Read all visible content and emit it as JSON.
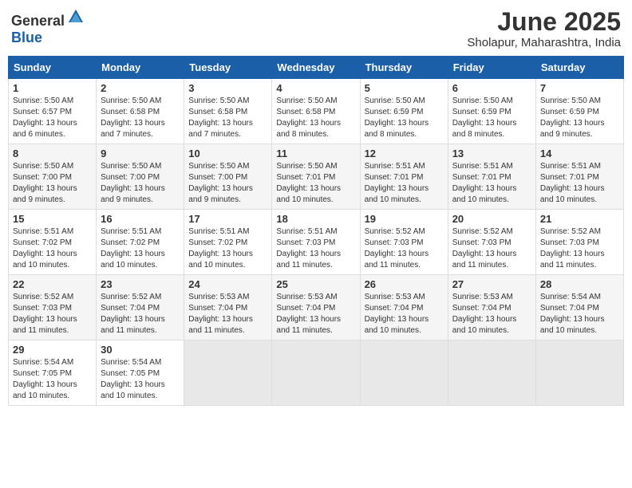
{
  "header": {
    "logo_general": "General",
    "logo_blue": "Blue",
    "month_title": "June 2025",
    "subtitle": "Sholapur, Maharashtra, India"
  },
  "days_of_week": [
    "Sunday",
    "Monday",
    "Tuesday",
    "Wednesday",
    "Thursday",
    "Friday",
    "Saturday"
  ],
  "weeks": [
    [
      {
        "day": "1",
        "sunrise": "5:50 AM",
        "sunset": "6:57 PM",
        "daylight": "13 hours and 6 minutes."
      },
      {
        "day": "2",
        "sunrise": "5:50 AM",
        "sunset": "6:58 PM",
        "daylight": "13 hours and 7 minutes."
      },
      {
        "day": "3",
        "sunrise": "5:50 AM",
        "sunset": "6:58 PM",
        "daylight": "13 hours and 7 minutes."
      },
      {
        "day": "4",
        "sunrise": "5:50 AM",
        "sunset": "6:58 PM",
        "daylight": "13 hours and 8 minutes."
      },
      {
        "day": "5",
        "sunrise": "5:50 AM",
        "sunset": "6:59 PM",
        "daylight": "13 hours and 8 minutes."
      },
      {
        "day": "6",
        "sunrise": "5:50 AM",
        "sunset": "6:59 PM",
        "daylight": "13 hours and 8 minutes."
      },
      {
        "day": "7",
        "sunrise": "5:50 AM",
        "sunset": "6:59 PM",
        "daylight": "13 hours and 9 minutes."
      }
    ],
    [
      {
        "day": "8",
        "sunrise": "5:50 AM",
        "sunset": "7:00 PM",
        "daylight": "13 hours and 9 minutes."
      },
      {
        "day": "9",
        "sunrise": "5:50 AM",
        "sunset": "7:00 PM",
        "daylight": "13 hours and 9 minutes."
      },
      {
        "day": "10",
        "sunrise": "5:50 AM",
        "sunset": "7:00 PM",
        "daylight": "13 hours and 9 minutes."
      },
      {
        "day": "11",
        "sunrise": "5:50 AM",
        "sunset": "7:01 PM",
        "daylight": "13 hours and 10 minutes."
      },
      {
        "day": "12",
        "sunrise": "5:51 AM",
        "sunset": "7:01 PM",
        "daylight": "13 hours and 10 minutes."
      },
      {
        "day": "13",
        "sunrise": "5:51 AM",
        "sunset": "7:01 PM",
        "daylight": "13 hours and 10 minutes."
      },
      {
        "day": "14",
        "sunrise": "5:51 AM",
        "sunset": "7:01 PM",
        "daylight": "13 hours and 10 minutes."
      }
    ],
    [
      {
        "day": "15",
        "sunrise": "5:51 AM",
        "sunset": "7:02 PM",
        "daylight": "13 hours and 10 minutes."
      },
      {
        "day": "16",
        "sunrise": "5:51 AM",
        "sunset": "7:02 PM",
        "daylight": "13 hours and 10 minutes."
      },
      {
        "day": "17",
        "sunrise": "5:51 AM",
        "sunset": "7:02 PM",
        "daylight": "13 hours and 10 minutes."
      },
      {
        "day": "18",
        "sunrise": "5:51 AM",
        "sunset": "7:03 PM",
        "daylight": "13 hours and 11 minutes."
      },
      {
        "day": "19",
        "sunrise": "5:52 AM",
        "sunset": "7:03 PM",
        "daylight": "13 hours and 11 minutes."
      },
      {
        "day": "20",
        "sunrise": "5:52 AM",
        "sunset": "7:03 PM",
        "daylight": "13 hours and 11 minutes."
      },
      {
        "day": "21",
        "sunrise": "5:52 AM",
        "sunset": "7:03 PM",
        "daylight": "13 hours and 11 minutes."
      }
    ],
    [
      {
        "day": "22",
        "sunrise": "5:52 AM",
        "sunset": "7:03 PM",
        "daylight": "13 hours and 11 minutes."
      },
      {
        "day": "23",
        "sunrise": "5:52 AM",
        "sunset": "7:04 PM",
        "daylight": "13 hours and 11 minutes."
      },
      {
        "day": "24",
        "sunrise": "5:53 AM",
        "sunset": "7:04 PM",
        "daylight": "13 hours and 11 minutes."
      },
      {
        "day": "25",
        "sunrise": "5:53 AM",
        "sunset": "7:04 PM",
        "daylight": "13 hours and 11 minutes."
      },
      {
        "day": "26",
        "sunrise": "5:53 AM",
        "sunset": "7:04 PM",
        "daylight": "13 hours and 10 minutes."
      },
      {
        "day": "27",
        "sunrise": "5:53 AM",
        "sunset": "7:04 PM",
        "daylight": "13 hours and 10 minutes."
      },
      {
        "day": "28",
        "sunrise": "5:54 AM",
        "sunset": "7:04 PM",
        "daylight": "13 hours and 10 minutes."
      }
    ],
    [
      {
        "day": "29",
        "sunrise": "5:54 AM",
        "sunset": "7:05 PM",
        "daylight": "13 hours and 10 minutes."
      },
      {
        "day": "30",
        "sunrise": "5:54 AM",
        "sunset": "7:05 PM",
        "daylight": "13 hours and 10 minutes."
      },
      null,
      null,
      null,
      null,
      null
    ]
  ],
  "labels": {
    "sunrise": "Sunrise:",
    "sunset": "Sunset:",
    "daylight": "Daylight:"
  }
}
